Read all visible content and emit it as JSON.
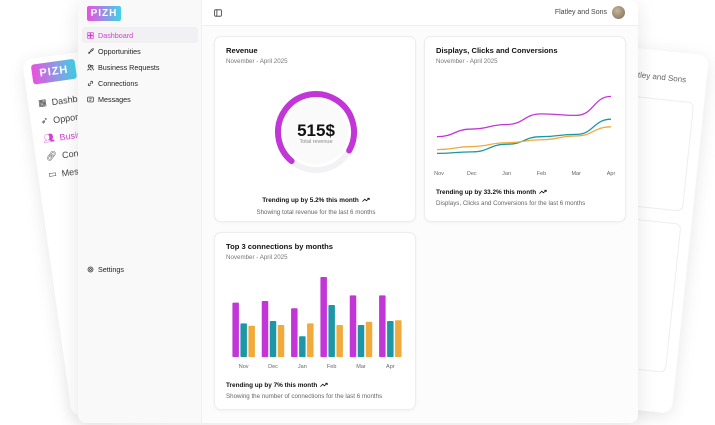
{
  "app": {
    "logo": "PIZH"
  },
  "colors": {
    "accent": "#d43fd1",
    "teal": "#1d97a6",
    "amber": "#f0ab3c",
    "magenta": "#c236d8"
  },
  "ghost_left": {
    "logo": "PIZH",
    "items": [
      {
        "label": "Dashboard",
        "icon": "dashboard-icon"
      },
      {
        "label": "Opportur",
        "icon": "rocket-icon"
      },
      {
        "label": "Busines",
        "icon": "users-icon"
      },
      {
        "label": "Conne",
        "icon": "link-icon"
      },
      {
        "label": "Messa",
        "icon": "message-icon"
      }
    ]
  },
  "ghost_right": {
    "user": "Flatley and Sons"
  },
  "sidebar": {
    "items": [
      {
        "label": "Dashboard",
        "icon": "dashboard-icon",
        "active": true
      },
      {
        "label": "Opportunities",
        "icon": "rocket-icon"
      },
      {
        "label": "Business Requests",
        "icon": "users-icon"
      },
      {
        "label": "Connections",
        "icon": "link-icon"
      },
      {
        "label": "Messages",
        "icon": "message-icon"
      }
    ],
    "settings_label": "Settings"
  },
  "topbar": {
    "user_name": "Flatley and Sons"
  },
  "revenue": {
    "title": "Revenue",
    "subtitle": "November - April 2025",
    "value": "515$",
    "value_caption": "Total revenue",
    "progress_fraction": 0.72,
    "trend": "Trending up by 5.2% this month",
    "note": "Showing total revenue for the last 6 months"
  },
  "displays": {
    "title": "Displays, Clicks and Conversions",
    "subtitle": "November - April 2025",
    "trend": "Trending up by 33.2% this month",
    "note": "Displays, Clicks and Conversions for the last 6 months"
  },
  "connections": {
    "title": "Top 3 connections by months",
    "subtitle": "November - April 2025",
    "trend": "Trending up by 7% this month",
    "note": "Showing the number of connections for the last 6 months"
  },
  "chart_data": [
    {
      "type": "line",
      "categories": [
        "Nov",
        "Dec",
        "Jan",
        "Feb",
        "Mar",
        "Apr"
      ],
      "ylim": [
        0,
        100
      ],
      "series": [
        {
          "values": [
            32,
            42,
            48,
            62,
            60,
            85
          ],
          "color": "#c236d8"
        },
        {
          "values": [
            10,
            12,
            22,
            32,
            35,
            55
          ],
          "color": "#1d97a6"
        },
        {
          "values": [
            15,
            19,
            24,
            28,
            33,
            45
          ],
          "color": "#f0ab3c"
        }
      ]
    },
    {
      "type": "bar",
      "categories": [
        "Nov",
        "Dec",
        "Jan",
        "Feb",
        "Mar",
        "Apr"
      ],
      "ylim": [
        0,
        100
      ],
      "series": [
        {
          "values": [
            68,
            70,
            61,
            100,
            77,
            77
          ],
          "color": "#c236d8"
        },
        {
          "values": [
            42,
            45,
            26,
            65,
            40,
            45
          ],
          "color": "#1d97a6"
        },
        {
          "values": [
            39,
            40,
            42,
            40,
            44,
            46
          ],
          "color": "#f0ab3c"
        }
      ]
    }
  ]
}
